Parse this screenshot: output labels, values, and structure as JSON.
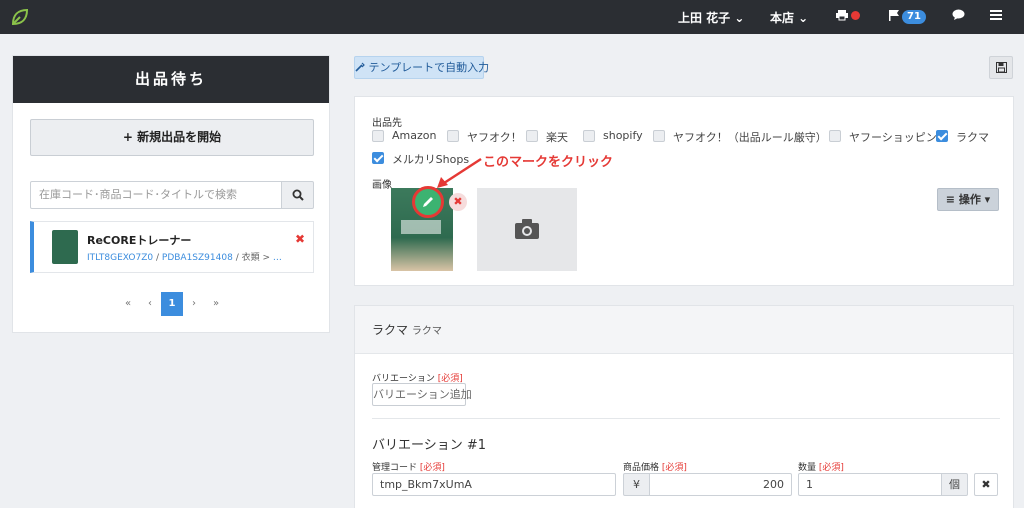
{
  "topbar": {
    "user": "上田 花子 ⌄",
    "store": "本店 ⌄",
    "flag_count": "71"
  },
  "left": {
    "heading": "出品待ち",
    "new_button": "+ 新規出品を開始",
    "search_placeholder": "在庫コード･商品コード･タイトルで検索",
    "item": {
      "title": "ReCOREトレーナー",
      "code1": "ITLT8GEXO7Z0",
      "code2": "PDBA1SZ91408",
      "category": " / 衣類 > メン..."
    },
    "pager": {
      "first": "«",
      "prev": "‹",
      "current": "1",
      "next": "›",
      "last": "»"
    }
  },
  "toolbar": {
    "template_button": "テンプレートで自動入力"
  },
  "listing": {
    "destination_label": "出品先",
    "channels": [
      {
        "label": "Amazon",
        "checked": false
      },
      {
        "label": "ヤフオク！",
        "checked": false
      },
      {
        "label": "楽天",
        "checked": false
      },
      {
        "label": "shopify",
        "checked": false
      },
      {
        "label": "ヤフオク！（出品ルール厳守）",
        "checked": false
      },
      {
        "label": "ヤフーショッピング",
        "checked": false
      },
      {
        "label": "ラクマ",
        "checked": true
      },
      {
        "label": "メルカリShops",
        "checked": true
      }
    ],
    "image_label": "画像",
    "annotation": "このマークをクリック",
    "ops_button": "≡ 操作 ▾"
  },
  "rakuma": {
    "title": "ラクマ",
    "subtitle": "ラクマ",
    "variation_label": "バリエーション",
    "required": "[必須]",
    "add_variation_button": "バリエーション追加",
    "variation_title": "バリエーション #1",
    "code_label": "管理コード",
    "code_value": "tmp_Bkm7xUmA",
    "price_label": "商品価格",
    "currency": "¥",
    "price_value": "200",
    "qty_label": "数量",
    "qty_value": "1",
    "qty_unit": "個",
    "remove_button": "✖"
  }
}
